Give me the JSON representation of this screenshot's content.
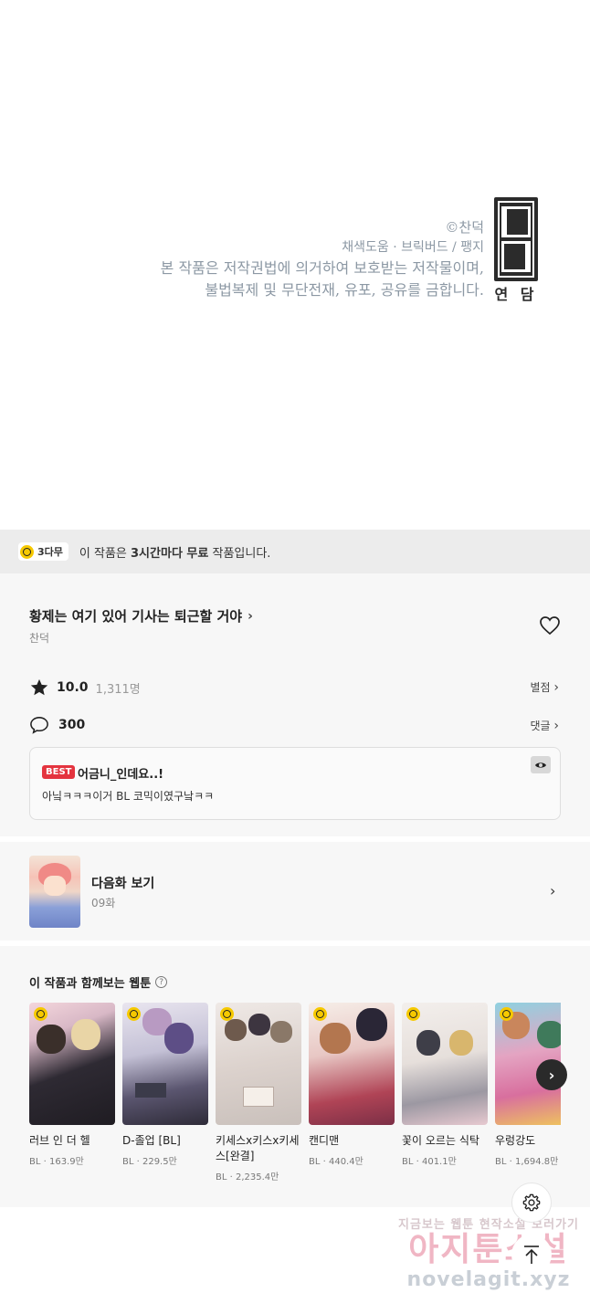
{
  "panel": {
    "copyright": "©찬덕",
    "staff": "채색도움 · 브릭버드 / 팽지",
    "notice_line1": "본 작품은 저작권법에 의거하여 보호받는 저작물이며,",
    "notice_line2": "불법복제 및 무단전재, 유포, 공유를 금합니다.",
    "publisher_label": "연 담"
  },
  "free_banner": {
    "badge": "3다무",
    "prefix": "이 작품은 ",
    "emphasis": "3시간마다 무료",
    "suffix": " 작품입니다."
  },
  "work": {
    "title": "황제는 여기 있어 기사는 퇴근할 거야",
    "author": "찬덕",
    "rating": "10.0",
    "rating_count": "1,311명",
    "rating_link": "별점",
    "comment_count": "300",
    "comment_link": "댓글"
  },
  "best_comment": {
    "tag": "BEST",
    "title": "어금니_인데요..!",
    "body": "아닠ㅋㅋㅋ이거 BL 코믹이였구낰ㅋㅋ"
  },
  "next_episode": {
    "label": "다음화 보기",
    "episode": "09화"
  },
  "recommendations": {
    "heading": "이 작품과 함께보는 웹툰",
    "items": [
      {
        "title": "러브 인 더 헬",
        "meta": "BL · 163.9만",
        "cover_color": "#3a3340"
      },
      {
        "title": "D-졸업 [BL]",
        "meta": "BL · 229.5만",
        "cover_color": "#b7b9cc"
      },
      {
        "title": "키세스x키스x키세스[완결]",
        "meta": "BL · 2,235.4만",
        "cover_color": "#d9d2cf"
      },
      {
        "title": "캔디맨",
        "meta": "BL · 440.4만",
        "cover_color": "#c98a8f"
      },
      {
        "title": "꽃이 오르는 식탁",
        "meta": "BL · 401.1만",
        "cover_color": "#ded6d2"
      },
      {
        "title": "우렁강도",
        "meta": "BL · 1,694.8만",
        "cover_color": "#d2a8c4"
      }
    ]
  },
  "watermark": {
    "line1": "지금보는 웹툰 현작소설 보러가기",
    "line2": "아지툰소설",
    "line3": "novelagit.xyz"
  },
  "icons": {
    "clock": "clock-icon",
    "heart": "heart-icon",
    "star": "star-icon",
    "comment": "speech-bubble-icon",
    "eye": "eye-icon",
    "gear": "gear-icon",
    "scroll_top": "arrow-up-icon"
  }
}
